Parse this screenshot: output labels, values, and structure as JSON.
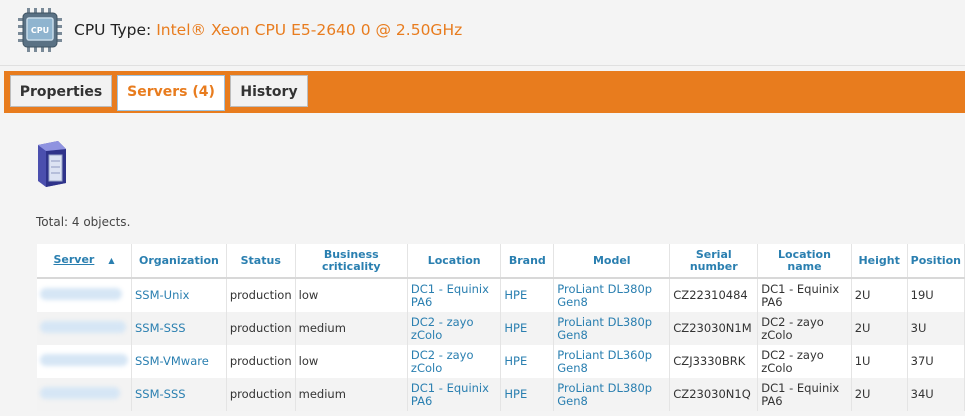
{
  "header": {
    "label": "CPU Type:",
    "cpu_name": "Intel® Xeon CPU E5-2640 0 @ 2.50GHz",
    "icon": "cpu-chip-icon",
    "icon_text": "CPU"
  },
  "tabs": [
    {
      "label": "Properties",
      "active": false
    },
    {
      "label": "Servers (4)",
      "active": true
    },
    {
      "label": "History",
      "active": false
    }
  ],
  "content": {
    "icon": "server-icon",
    "total_text": "Total: 4 objects."
  },
  "table": {
    "sort_arrow": "▲",
    "columns": [
      "Server",
      "Organization",
      "Status",
      "Business criticality",
      "Location",
      "Brand",
      "Model",
      "Serial number",
      "Location name",
      "Height",
      "Position"
    ],
    "rows": [
      {
        "organization": "SSM-Unix",
        "status": "production",
        "criticality": "low",
        "location": "DC1 - Equinix PA6",
        "brand": "HPE",
        "model": "ProLiant DL380p Gen8",
        "serial": "CZ22310484",
        "location_name": "DC1 - Equinix PA6",
        "height": "2U",
        "position": "19U"
      },
      {
        "organization": "SSM-SSS",
        "status": "production",
        "criticality": "medium",
        "location": "DC2 - zayo zColo",
        "brand": "HPE",
        "model": "ProLiant DL380p Gen8",
        "serial": "CZ23030N1M",
        "location_name": "DC2 - zayo zColo",
        "height": "2U",
        "position": "3U"
      },
      {
        "organization": "SSM-VMware",
        "status": "production",
        "criticality": "low",
        "location": "DC2 - zayo zColo",
        "brand": "HPE",
        "model": "ProLiant DL360p Gen8",
        "serial": "CZJ3330BRK",
        "location_name": "DC2 - zayo zColo",
        "height": "1U",
        "position": "37U"
      },
      {
        "organization": "SSM-SSS",
        "status": "production",
        "criticality": "medium",
        "location": "DC1 - Equinix PA6",
        "brand": "HPE",
        "model": "ProLiant DL380p Gen8",
        "serial": "CZ23030N1Q",
        "location_name": "DC1 - Equinix PA6",
        "height": "2U",
        "position": "34U"
      }
    ]
  },
  "colors": {
    "accent": "#e87c1e",
    "link": "#2a7fb0"
  }
}
